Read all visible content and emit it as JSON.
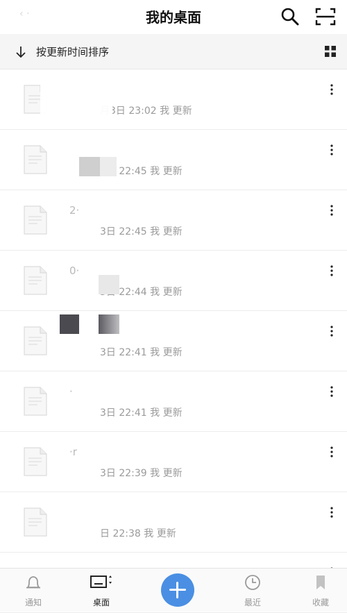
{
  "header": {
    "title": "我的桌面",
    "back_hint": "‹ ·"
  },
  "sort_bar": {
    "label": "按更新时间排序"
  },
  "files": [
    {
      "name": "",
      "meta": "月3日 23:02 我 更新"
    },
    {
      "name": "",
      "meta": "3日 22:45 我 更新"
    },
    {
      "name": "2·",
      "meta": "3日 22:45 我 更新"
    },
    {
      "name": "0·",
      "meta": "3日 22:44 我 更新"
    },
    {
      "name": "",
      "meta": "3日 22:41 我 更新"
    },
    {
      "name": "·",
      "meta": "3日 22:41 我 更新"
    },
    {
      "name": "·r",
      "meta": "3日 22:39 我 更新"
    },
    {
      "name": "",
      "meta": "日 22:38 我 更新"
    },
    {
      "name": "·",
      "meta": ""
    }
  ],
  "tabs": [
    {
      "label": "通知",
      "icon": "bell-icon"
    },
    {
      "label": "桌面",
      "icon": "desktop-icon"
    },
    {
      "label": "最近",
      "icon": "clock-icon"
    },
    {
      "label": "收藏",
      "icon": "bookmark-icon"
    }
  ],
  "colors": {
    "accent": "#4a8fe3",
    "text_secondary": "#9a9a9a",
    "divider": "#ececec"
  }
}
